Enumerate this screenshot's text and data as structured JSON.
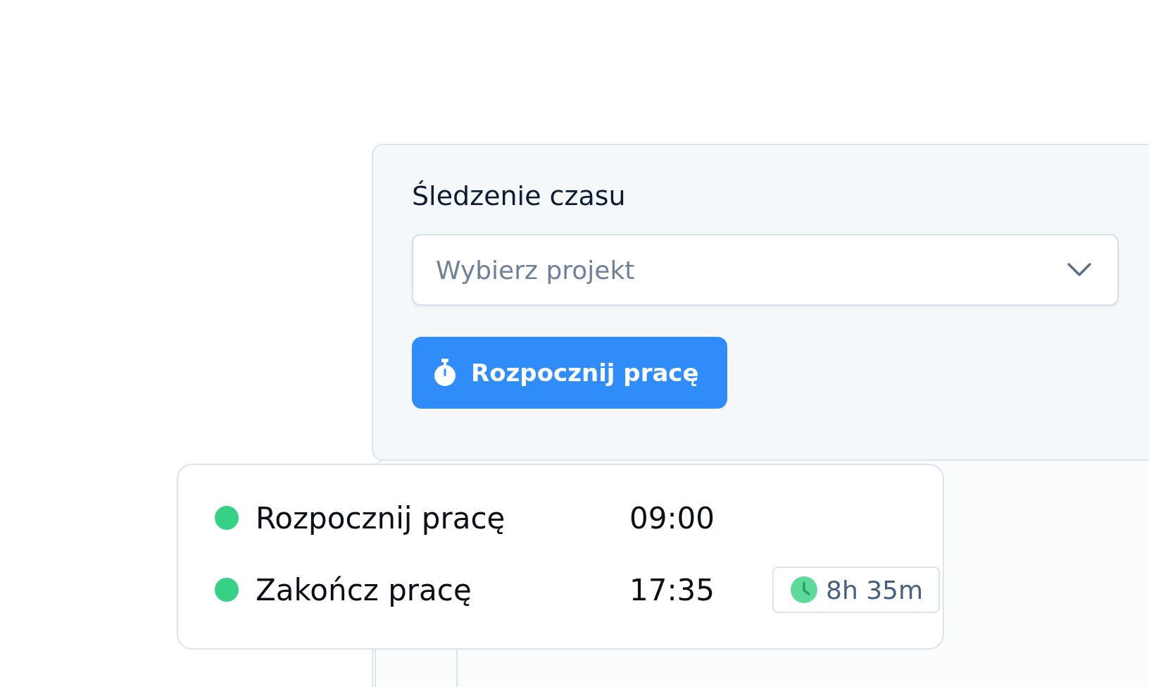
{
  "panel": {
    "title": "Śledzenie czasu",
    "project_select": {
      "placeholder": "Wybierz projekt"
    },
    "start_button": {
      "label": "Rozpocznij pracę"
    }
  },
  "log": {
    "rows": [
      {
        "label": "Rozpocznij pracę",
        "time": "09:00",
        "color": "#36d185"
      },
      {
        "label": "Zakończ pracę",
        "time": "17:35",
        "color": "#36d185",
        "duration": "8h 35m"
      }
    ]
  }
}
